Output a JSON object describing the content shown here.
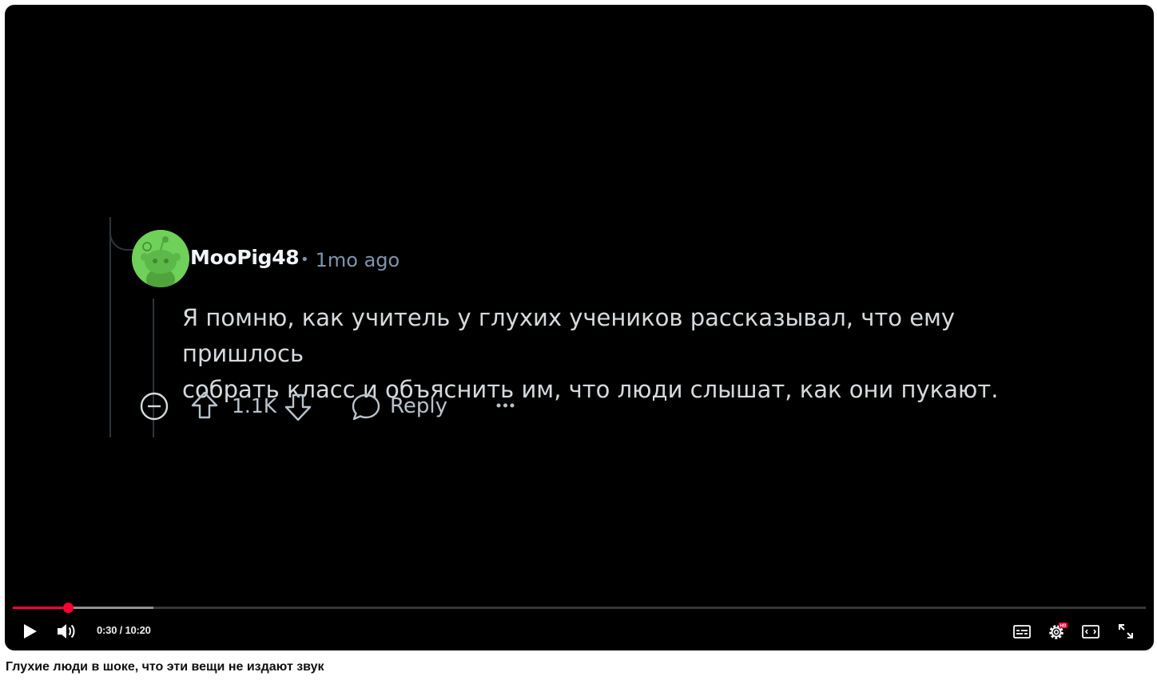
{
  "comment": {
    "author": "MooPig48",
    "separator": "•",
    "time_ago": "1mo ago",
    "text_line1": "Я помню, как учитель у глухих учеников рассказывал, что ему пришлось",
    "text_line2": "собрать класс и объяснить им, что люди слышат, как они пукают.",
    "votes": "1.1K",
    "reply_label": "Reply",
    "more_label": "···",
    "avatar_color": "#6fd05a"
  },
  "player": {
    "current_time": "0:30",
    "duration": "10:20",
    "time_display": "0:30 / 10:20",
    "progress_fraction": 0.0484,
    "buffer_fraction": 0.124,
    "accent_color": "#ff0033",
    "controls": [
      "play-icon",
      "volume-icon",
      "subtitles-icon",
      "settings-icon",
      "theater-mode-icon",
      "fullscreen-icon"
    ],
    "hd_badge": "HD"
  },
  "video_title": "Глухие люди в шоке, что эти вещи не издают звук"
}
